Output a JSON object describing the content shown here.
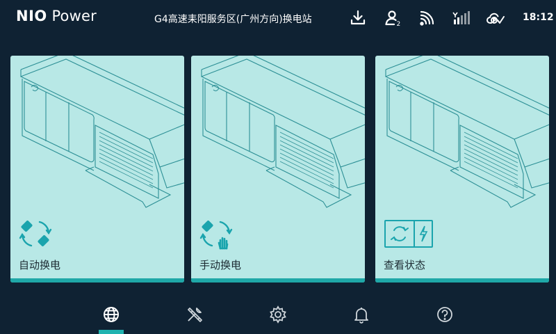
{
  "header": {
    "brand": "NIO",
    "brand_sub": "Power",
    "station_name": "G4高速耒阳服务区(广州方向)换电站",
    "time": "18:12",
    "status_icons": [
      "download-icon",
      "user-icon",
      "signal-icon",
      "cellular-icon",
      "cloud-check-icon"
    ],
    "user_badge": "2"
  },
  "cards": [
    {
      "label": "自动换电",
      "icon": "auto-swap-icon"
    },
    {
      "label": "手动换电",
      "icon": "manual-swap-icon"
    },
    {
      "label": "查看状态",
      "icon": "status-view-icon"
    }
  ],
  "nav": {
    "items": [
      "globe-icon",
      "tools-icon",
      "settings-icon",
      "bell-icon",
      "help-icon"
    ],
    "active_index": 0
  },
  "colors": {
    "background": "#0f2233",
    "card": "#b8e8e6",
    "accent": "#1fa8a8",
    "line": "#2c8f95"
  }
}
